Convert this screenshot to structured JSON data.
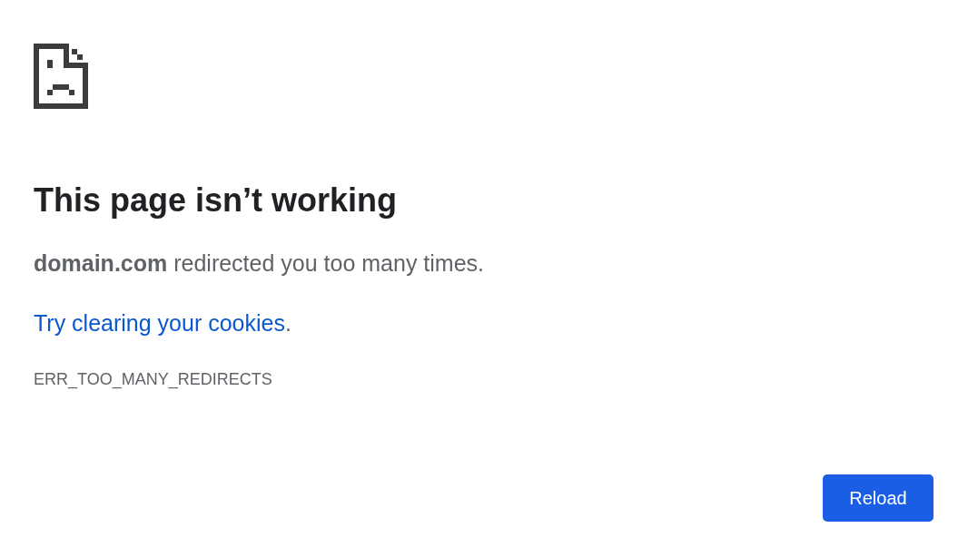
{
  "heading": "This page isn’t working",
  "message": "**domain.com** redirected you too many times.",
  "suggestion": {
    "link": "Try clearing your cookies",
    "trailing": "."
  },
  "error_code": "ERR_TOO_MANY_REDIRECTS",
  "buttons": [
    "Reload"
  ]
}
